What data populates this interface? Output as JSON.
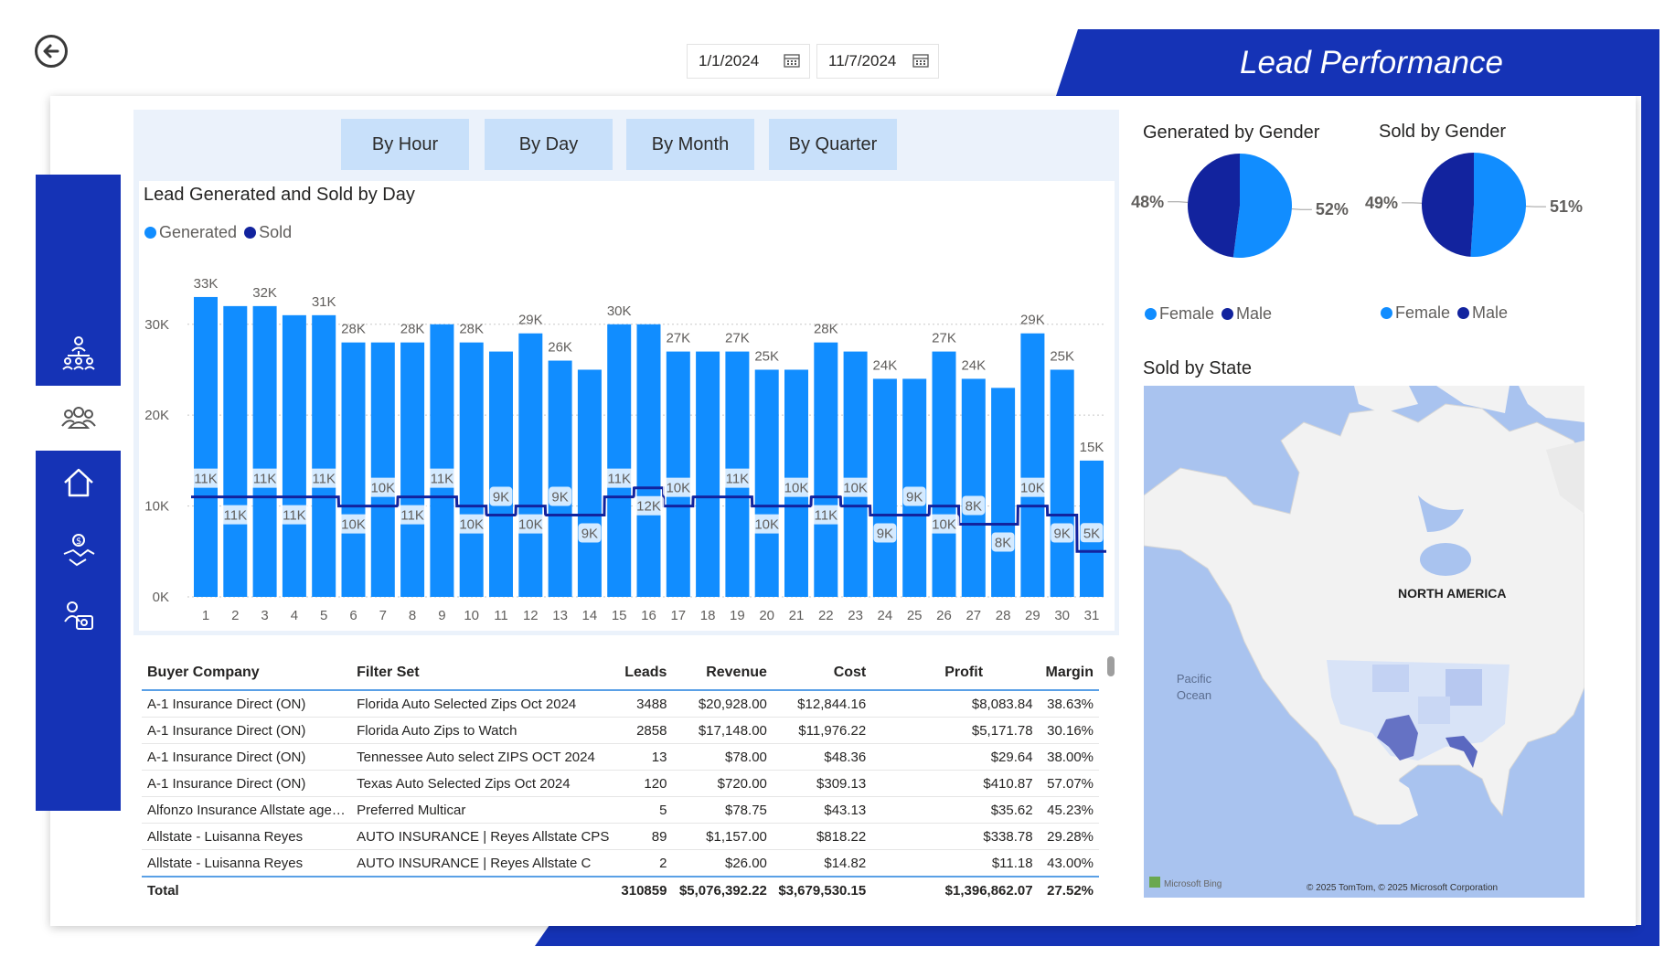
{
  "header": {
    "title": "Lead Performance"
  },
  "date_range": {
    "start": "1/1/2024",
    "end": "11/7/2024"
  },
  "tabs": [
    {
      "label": "By Hour"
    },
    {
      "label": "By Day"
    },
    {
      "label": "By Month"
    },
    {
      "label": "By Quarter"
    }
  ],
  "sidebar": {
    "items": [
      {
        "icon": "org-chart-icon"
      },
      {
        "icon": "people-group-icon",
        "active": true
      },
      {
        "icon": "home-icon"
      },
      {
        "icon": "handshake-money-icon"
      },
      {
        "icon": "team-icon"
      }
    ]
  },
  "colors": {
    "accent": "#1533b6",
    "generated": "#118dff",
    "sold": "#12239e",
    "tab": "#c8e0fa"
  },
  "chart_data": [
    {
      "type": "bar",
      "title": "Lead Generated and Sold by Day",
      "categories": [
        "1",
        "2",
        "3",
        "4",
        "5",
        "6",
        "7",
        "8",
        "9",
        "10",
        "11",
        "12",
        "13",
        "14",
        "15",
        "16",
        "17",
        "18",
        "19",
        "20",
        "21",
        "22",
        "23",
        "24",
        "25",
        "26",
        "27",
        "28",
        "29",
        "30",
        "31"
      ],
      "series": [
        {
          "name": "Generated",
          "type": "bar",
          "values": [
            33,
            32,
            32,
            31,
            31,
            28,
            28,
            28,
            30,
            28,
            27,
            29,
            26,
            25,
            30,
            30,
            27,
            27,
            27,
            25,
            25,
            28,
            27,
            24,
            24,
            27,
            24,
            23,
            29,
            25,
            15
          ],
          "labels": [
            "33K",
            "",
            "32K",
            "",
            "31K",
            "28K",
            "",
            "28K",
            "",
            "28K",
            "",
            "29K",
            "26K",
            "",
            "30K",
            "",
            "27K",
            "",
            "27K",
            "25K",
            "",
            "28K",
            "",
            "24K",
            "",
            "27K",
            "24K",
            "",
            "29K",
            "25K",
            "15K"
          ]
        },
        {
          "name": "Sold",
          "type": "line",
          "values": [
            11,
            11,
            11,
            11,
            11,
            10,
            10,
            11,
            11,
            10,
            9,
            10,
            9,
            9,
            11,
            12,
            10,
            11,
            11,
            10,
            10,
            11,
            10,
            9,
            9,
            10,
            8,
            8,
            10,
            9,
            5
          ],
          "labels": [
            "11K",
            "11K",
            "11K",
            "11K",
            "11K",
            "10K",
            "10K",
            "11K",
            "11K",
            "10K",
            "9K",
            "10K",
            "9K",
            "9K",
            "11K",
            "12K",
            "10K",
            "",
            "11K",
            "10K",
            "10K",
            "11K",
            "10K",
            "9K",
            "9K",
            "10K",
            "8K",
            "8K",
            "10K",
            "9K",
            "5K"
          ]
        }
      ],
      "y_ticks": [
        "0K",
        "10K",
        "20K",
        "30K"
      ],
      "ylim": [
        0,
        34
      ],
      "legend": "top-left",
      "grid": true
    },
    {
      "type": "pie",
      "title": "Generated by Gender",
      "slices": [
        {
          "name": "Female",
          "value": 52,
          "label": "52%"
        },
        {
          "name": "Male",
          "value": 48,
          "label": "48%"
        }
      ]
    },
    {
      "type": "pie",
      "title": "Sold by Gender",
      "slices": [
        {
          "name": "Female",
          "value": 51,
          "label": "51%"
        },
        {
          "name": "Male",
          "value": 49,
          "label": "49%"
        }
      ]
    }
  ],
  "legend_labels": {
    "generated": "Generated",
    "sold": "Sold",
    "female": "Female",
    "male": "Male"
  },
  "gender": {
    "generated_title": "Generated by Gender",
    "sold_title": "Sold by Gender"
  },
  "map": {
    "title": "Sold by State",
    "continent_label": "NORTH AMERICA",
    "ocean_label_1": "Pacific",
    "ocean_label_2": "Ocean",
    "brand": "Microsoft Bing",
    "copyright": "© 2025 TomTom, © 2025 Microsoft Corporation"
  },
  "table": {
    "columns": [
      "Buyer Company",
      "Filter Set",
      "Leads",
      "Revenue",
      "Cost",
      "Profit",
      "Margin"
    ],
    "rows": [
      [
        "A-1 Insurance Direct (ON)",
        "Florida Auto Selected Zips Oct 2024",
        "3488",
        "$20,928.00",
        "$12,844.16",
        "$8,083.84",
        "38.63%"
      ],
      [
        "A-1 Insurance Direct (ON)",
        "Florida Auto Zips to Watch",
        "2858",
        "$17,148.00",
        "$11,976.22",
        "$5,171.78",
        "30.16%"
      ],
      [
        "A-1 Insurance Direct (ON)",
        "Tennessee Auto select ZIPS OCT 2024",
        "13",
        "$78.00",
        "$48.36",
        "$29.64",
        "38.00%"
      ],
      [
        "A-1 Insurance Direct (ON)",
        "Texas Auto Selected Zips Oct 2024",
        "120",
        "$720.00",
        "$309.13",
        "$410.87",
        "57.07%"
      ],
      [
        "Alfonzo Insurance Allstate age…",
        "Preferred Multicar",
        "5",
        "$78.75",
        "$43.13",
        "$35.62",
        "45.23%"
      ],
      [
        "Allstate  - Luisanna Reyes",
        "AUTO INSURANCE | Reyes Allstate CPS",
        "89",
        "$1,157.00",
        "$818.22",
        "$338.78",
        "29.28%"
      ],
      [
        "Allstate  - Luisanna Reyes",
        "AUTO INSURANCE | Reyes Allstate C",
        "2",
        "$26.00",
        "$14.82",
        "$11.18",
        "43.00%"
      ]
    ],
    "total": [
      "Total",
      "",
      "310859",
      "$5,076,392.22",
      "$3,679,530.15",
      "$1,396,862.07",
      "27.52%"
    ]
  }
}
